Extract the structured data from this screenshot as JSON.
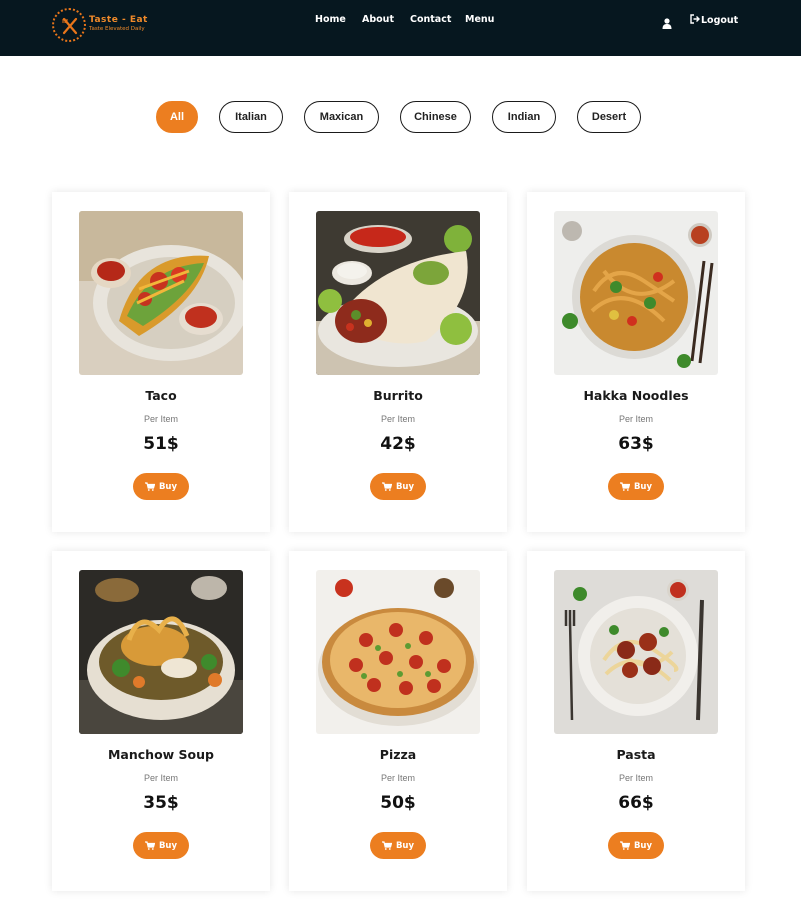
{
  "brand": {
    "title": "Taste - Eat",
    "tagline": "Taste Elevated Daily",
    "badge_text": "Taste Eat Taste Eat",
    "accent_color": "#ec7e20",
    "nav_bg": "#06171f"
  },
  "nav": {
    "links": [
      "Home",
      "About",
      "Contact",
      "Menu"
    ],
    "user_icon": "user-icon",
    "logout_icon": "logout-icon",
    "logout_label": "Logout"
  },
  "filters": {
    "items": [
      "All",
      "Italian",
      "Maxican",
      "Chinese",
      "Indian",
      "Desert"
    ],
    "active": "All"
  },
  "products": [
    {
      "name": "Taco",
      "per": "Per Item",
      "price": "51$",
      "buy": "Buy",
      "icon": "cart-icon"
    },
    {
      "name": "Burrito",
      "per": "Per Item",
      "price": "42$",
      "buy": "Buy",
      "icon": "cart-icon"
    },
    {
      "name": "Hakka Noodles",
      "per": "Per Item",
      "price": "63$",
      "buy": "Buy",
      "icon": "cart-icon"
    },
    {
      "name": "Manchow Soup",
      "per": "Per Item",
      "price": "35$",
      "buy": "Buy",
      "icon": "cart-icon"
    },
    {
      "name": "Pizza",
      "per": "Per Item",
      "price": "50$",
      "buy": "Buy",
      "icon": "cart-icon"
    },
    {
      "name": "Pasta",
      "per": "Per Item",
      "price": "66$",
      "buy": "Buy",
      "icon": "cart-icon"
    }
  ]
}
